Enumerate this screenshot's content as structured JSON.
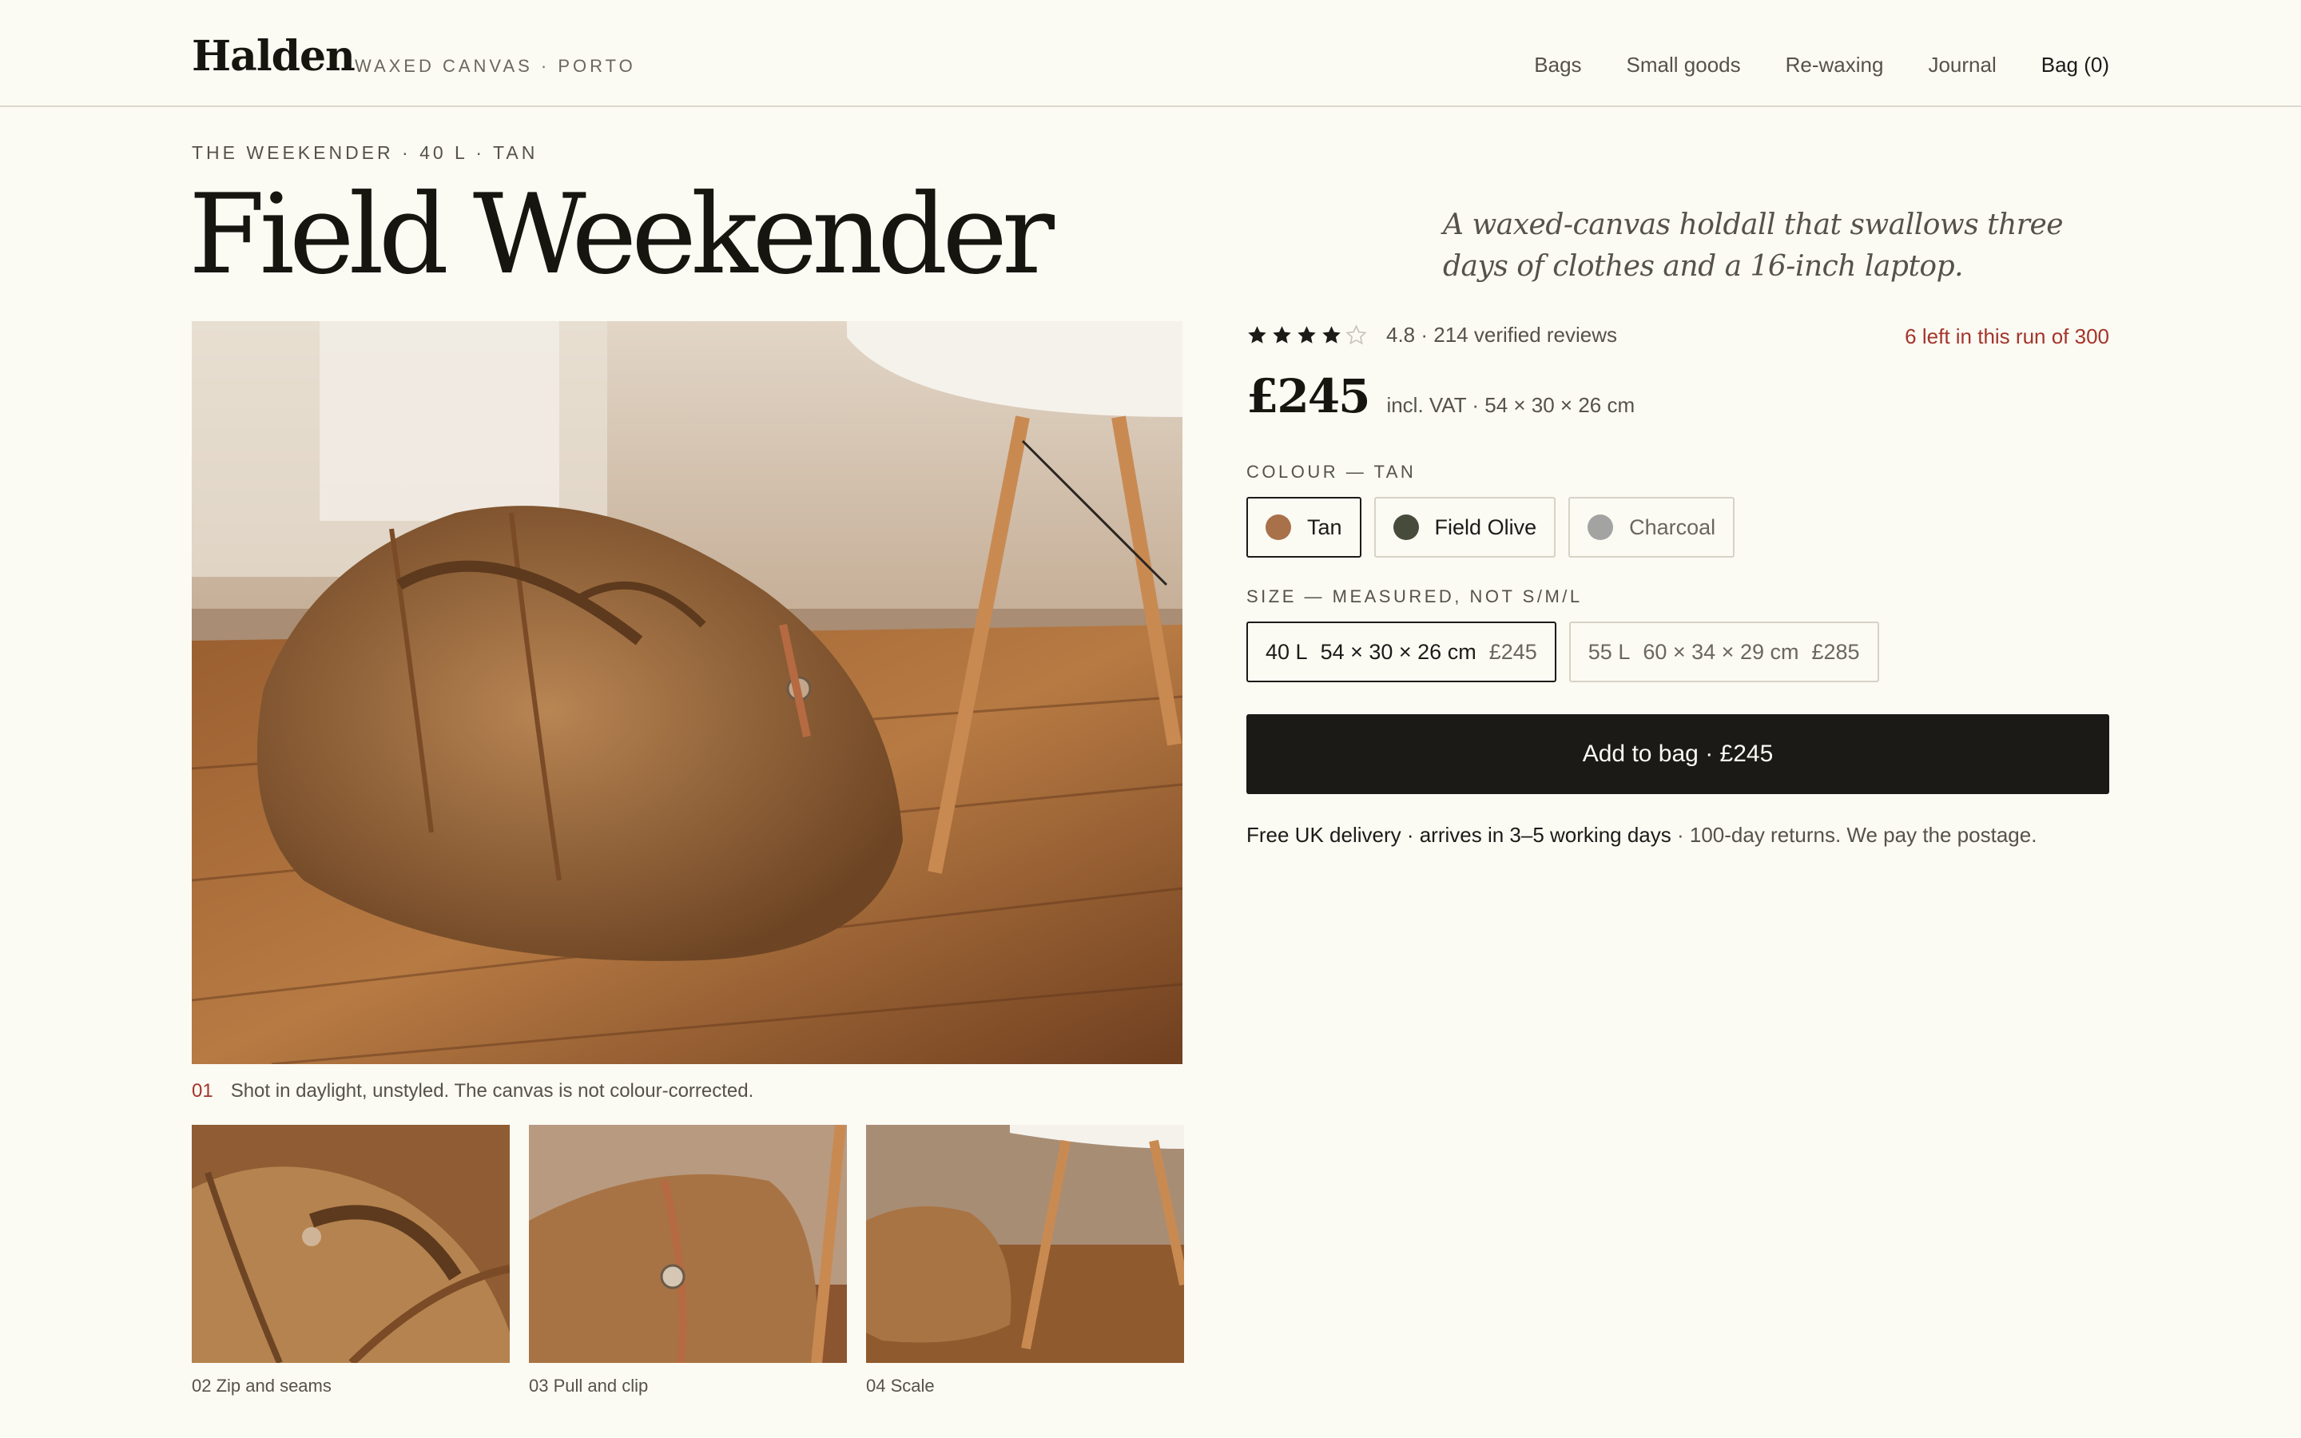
{
  "header": {
    "brand": "Halden",
    "brand_sub": "WAXED CANVAS · PORTO",
    "nav": [
      "Bags",
      "Small goods",
      "Re-waxing",
      "Journal"
    ],
    "bag_label": "Bag (0)"
  },
  "product": {
    "eyebrow": "THE WEEKENDER · 40 L · TAN",
    "title": "Field Weekender",
    "tagline": "A waxed-canvas holdall that swallows three days of clothes and a 16-inch laptop.",
    "rating": {
      "stars": 4,
      "of": 5,
      "text": "4.8 · 214 verified reviews"
    },
    "stock": "6 left in this run of 300",
    "price": "£245",
    "price_meta": "incl. VAT · 54 × 30 × 26 cm"
  },
  "gallery": {
    "caption_num": "01",
    "caption": "Shot in daylight, unstyled. The canvas is not colour-corrected.",
    "thumbs": [
      "02  Zip and seams",
      "03  Pull and clip",
      "04  Scale"
    ]
  },
  "colour": {
    "label": "COLOUR — TAN",
    "options": [
      {
        "name": "Tan",
        "color": "#a8714a"
      },
      {
        "name": "Field Olive",
        "color": "#474b3c"
      },
      {
        "name": "Charcoal",
        "color": "#a3a3a1"
      }
    ]
  },
  "size": {
    "label": "SIZE — MEASURED, NOT S/M/L",
    "options": [
      {
        "l": "40 L",
        "dims": "54 × 30 × 26 cm",
        "price": "£245"
      },
      {
        "l": "55 L",
        "dims": "60 × 34 × 29 cm",
        "price": "£285"
      }
    ]
  },
  "cta": {
    "label": "Add to bag · £245"
  },
  "delivery": {
    "strong": "Free UK delivery · arrives in 3–5 working days",
    "rest": " · 100-day returns. We pay the postage."
  },
  "colors": {
    "accent_red": "#a3352b",
    "ink": "#1b1a16",
    "paper": "#fbfaf3"
  }
}
